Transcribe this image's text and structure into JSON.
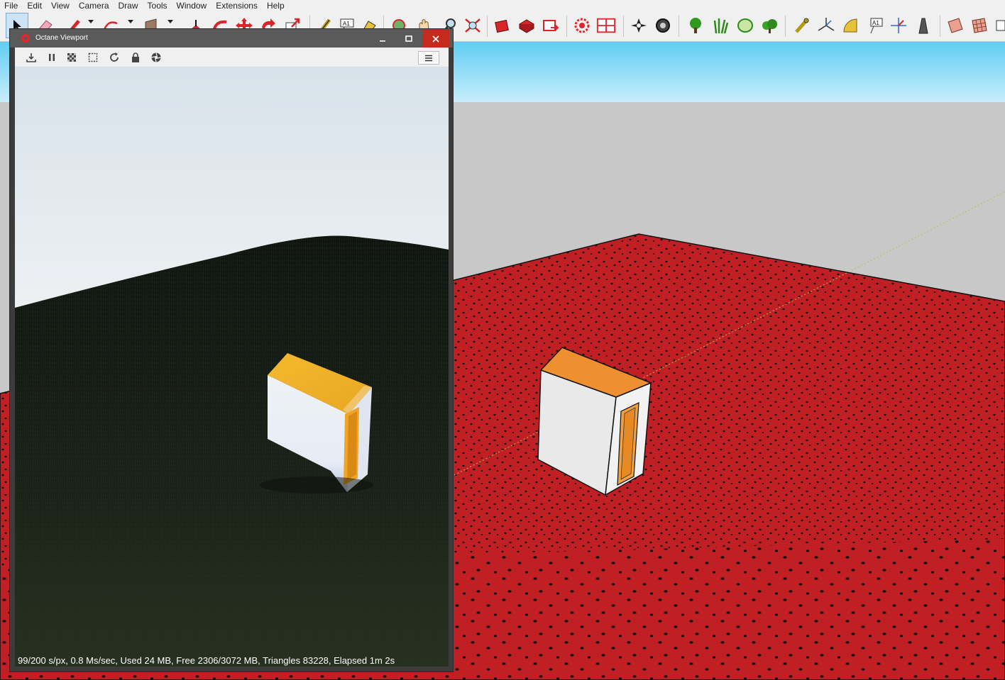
{
  "menu": [
    "File",
    "Edit",
    "View",
    "Camera",
    "Draw",
    "Tools",
    "Window",
    "Extensions",
    "Help"
  ],
  "toolbar": {
    "tools": [
      "select-tool",
      "eraser-tool",
      "pencil-tool",
      "arc-tool",
      "push-pull-tool",
      "move-tool",
      "rotate-tool",
      "scale-tool",
      "offset-tool",
      "tape-measure-tool",
      "text-tool",
      "paint-bucket-tool",
      "orbit-tool",
      "pan-tool",
      "zoom-tool",
      "zoom-extents-tool",
      "warehouse-tool",
      "extension-warehouse-tool",
      "send-to-layout-tool",
      "octane-render-tool",
      "octane-viewport-tool",
      "octane-settings-tool",
      "octane-material-tool",
      "tree-tool",
      "grass-tool",
      "shrub-tool",
      "bush-tool",
      "dimension-tool",
      "protractor-tool",
      "axes-tool",
      "3d-text-tool",
      "section-plane-tool",
      "sandbox-tool",
      "terrain-tool"
    ],
    "text_icon_label": "A1"
  },
  "octane": {
    "title": "Octane Viewport",
    "status": "99/200 s/px, 0.8 Ms/sec, Used 24 MB, Free 2306/3072 MB, Triangles 83228, Elapsed 1m 2s",
    "tools": [
      "download-icon",
      "pause-icon",
      "checker-icon",
      "region-icon",
      "refresh-icon",
      "lock-icon",
      "aperture-icon"
    ]
  },
  "colors": {
    "ground": "#c01f24",
    "sky": "#a5e4fa",
    "roof": "#ef9030",
    "grass": "#121812",
    "chrome": "#f0f0f0"
  }
}
